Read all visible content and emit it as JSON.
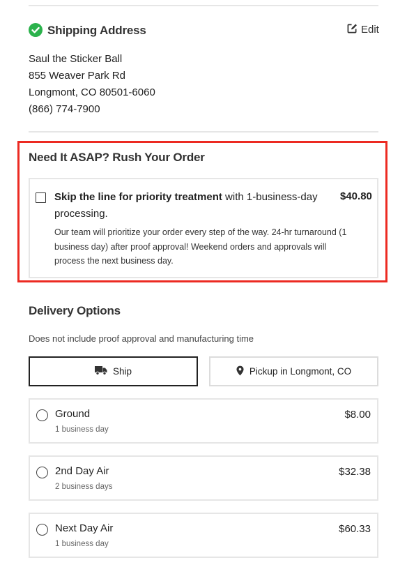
{
  "shipping": {
    "title": "Shipping Address",
    "edit_label": "Edit",
    "address_lines": [
      "Saul the Sticker Ball",
      "855 Weaver Park Rd",
      "Longmont, CO 80501-6060",
      "(866) 774-7900"
    ]
  },
  "rush": {
    "title": "Need It ASAP? Rush Your Order",
    "checked": false,
    "main_bold": "Skip the line for priority treatment",
    "main_rest": " with 1-business-day processing.",
    "price": "$40.80",
    "description": "Our team will prioritize your order every step of the way. 24-hr turnaround (1 business day) after proof approval! Weekend orders and approvals will process the next business day."
  },
  "delivery": {
    "title": "Delivery Options",
    "subtitle": "Does not include proof approval and manufacturing time",
    "tabs": [
      {
        "label": "Ship",
        "icon": "truck-icon",
        "selected": true
      },
      {
        "label": "Pickup in Longmont, CO",
        "icon": "map-pin-icon",
        "selected": false
      }
    ],
    "options": [
      {
        "name": "Ground",
        "time": "1 business day",
        "price": "$8.00"
      },
      {
        "name": "2nd Day Air",
        "time": "2 business days",
        "price": "$32.38"
      },
      {
        "name": "Next Day Air",
        "time": "1 business day",
        "price": "$60.33"
      }
    ]
  },
  "colors": {
    "success_green": "#2bb24c",
    "highlight_red": "#ec2a22",
    "border_gray": "#e6e6e6",
    "text_dark": "#222222"
  }
}
